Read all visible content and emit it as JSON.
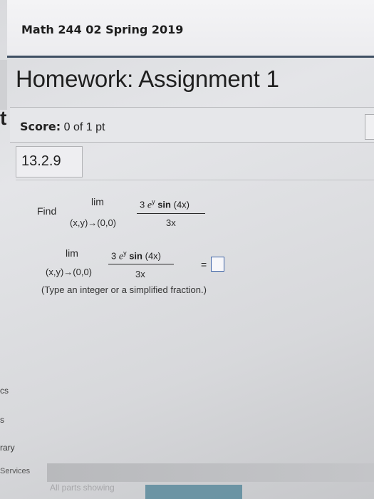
{
  "header": {
    "course": "Math 244 02 Spring 2019"
  },
  "assignment": {
    "title": "Homework: Assignment 1"
  },
  "score": {
    "label": "Score:",
    "value": "0 of 1 pt"
  },
  "question": {
    "number": "13.2.9",
    "find_label": "Find",
    "lim": "lim",
    "subscript": "(x,y)→(0,0)",
    "numerator_coef": "3",
    "numerator_e": "e",
    "numerator_sup": "y",
    "numerator_sin": "sin",
    "numerator_arg": "(4x)",
    "denominator": "3x",
    "equals": "=",
    "hint": "(Type an integer or a simplified fraction.)"
  },
  "side_fragments": {
    "item1": "cs",
    "item2": "s",
    "item3": "rary",
    "services": "Services"
  },
  "footer": {
    "text": "All parts showing"
  }
}
